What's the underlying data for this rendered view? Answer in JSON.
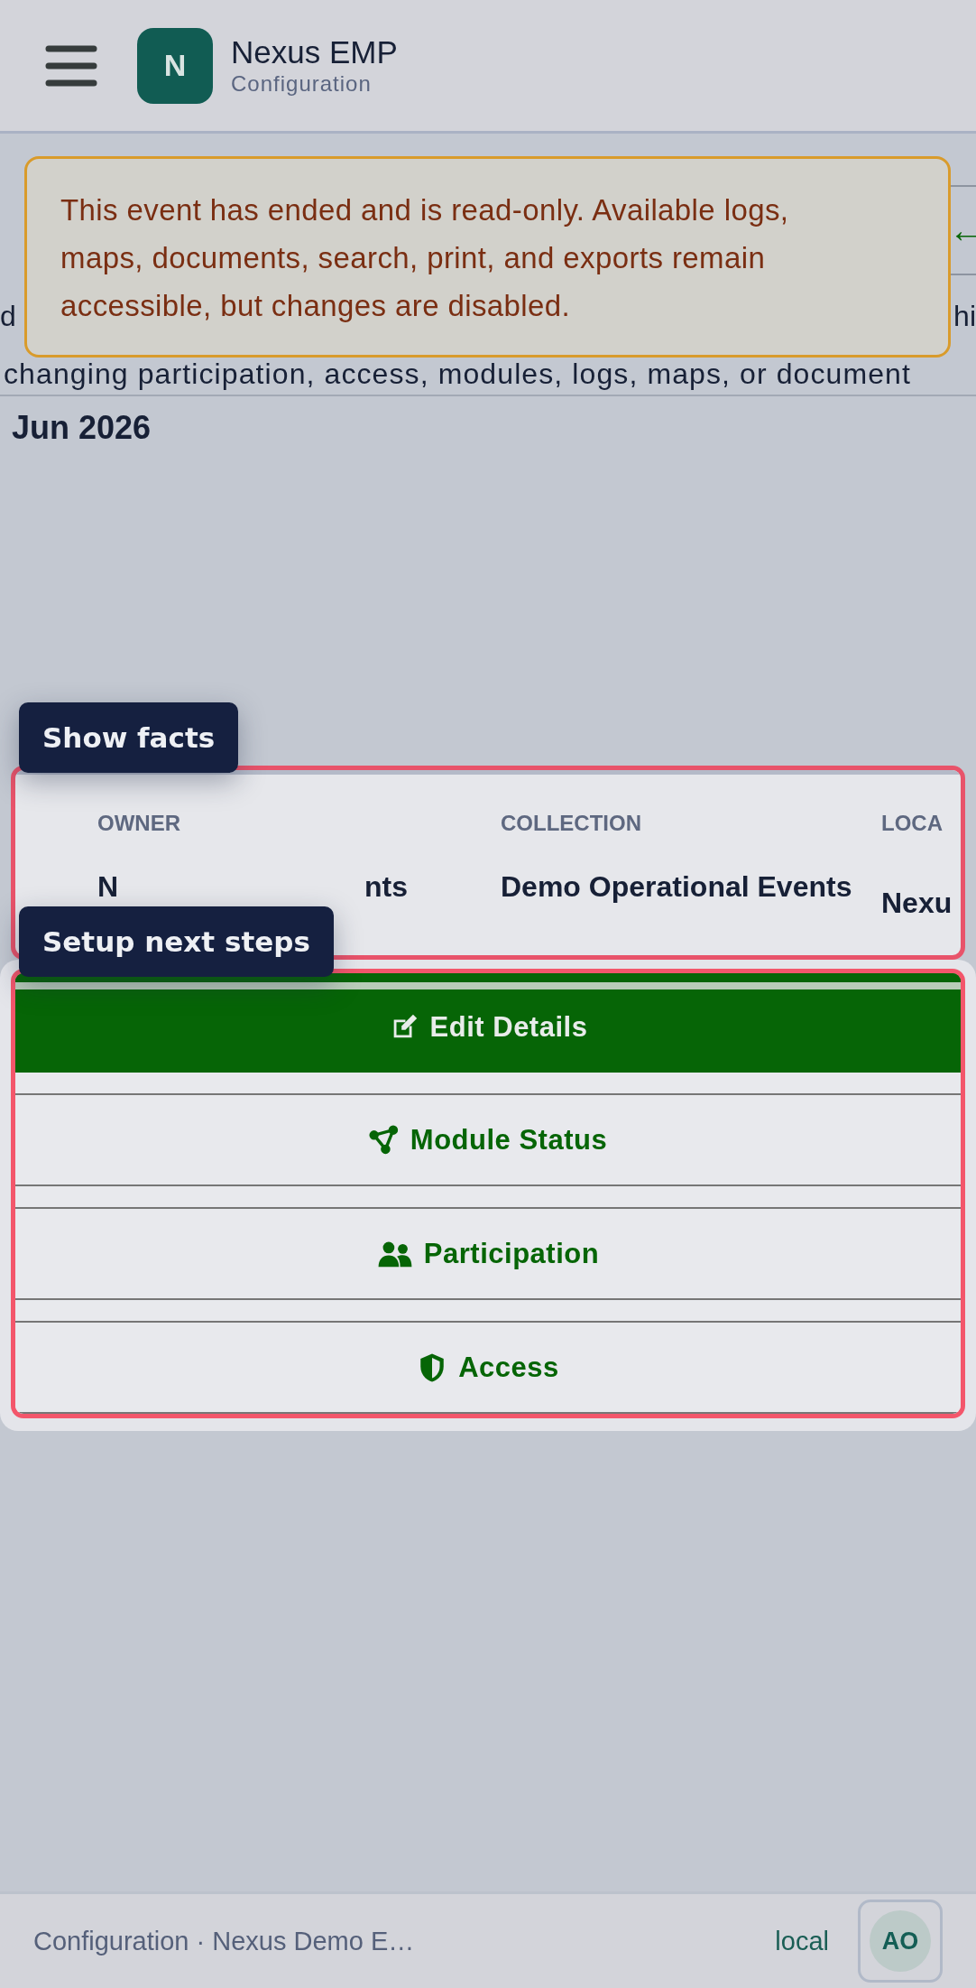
{
  "header": {
    "title": "Nexus EMP",
    "subtitle": "Configuration",
    "logo_letter": "N"
  },
  "notice": {
    "text": "This event has ended and is read-only. Available logs, maps, documents, search, print, and exports remain accessible, but changes are disabled."
  },
  "background": {
    "back_arrow": "←",
    "fragment_left": "d",
    "fragment_right": "hi",
    "description": "changing participation, access, modules, logs, maps, or document",
    "date": "Jun 2026"
  },
  "tour_tips": [
    {
      "label": "Show facts"
    },
    {
      "label": "Setup next steps"
    }
  ],
  "facts": [
    {
      "label": "OWNER",
      "value_parts": [
        "N",
        "nts"
      ]
    },
    {
      "label": "COLLECTION",
      "value": "Demo Operational Events"
    },
    {
      "label": "LOCA",
      "value": "Nexu"
    }
  ],
  "actions": [
    {
      "label": "Edit Details",
      "primary": true
    },
    {
      "label": "Module Status",
      "primary": false
    },
    {
      "label": "Participation",
      "primary": false
    },
    {
      "label": "Access",
      "primary": false
    }
  ],
  "status_bar": {
    "text": "Configuration · Nexus Demo E…",
    "environment": "local",
    "avatar": "AO"
  }
}
